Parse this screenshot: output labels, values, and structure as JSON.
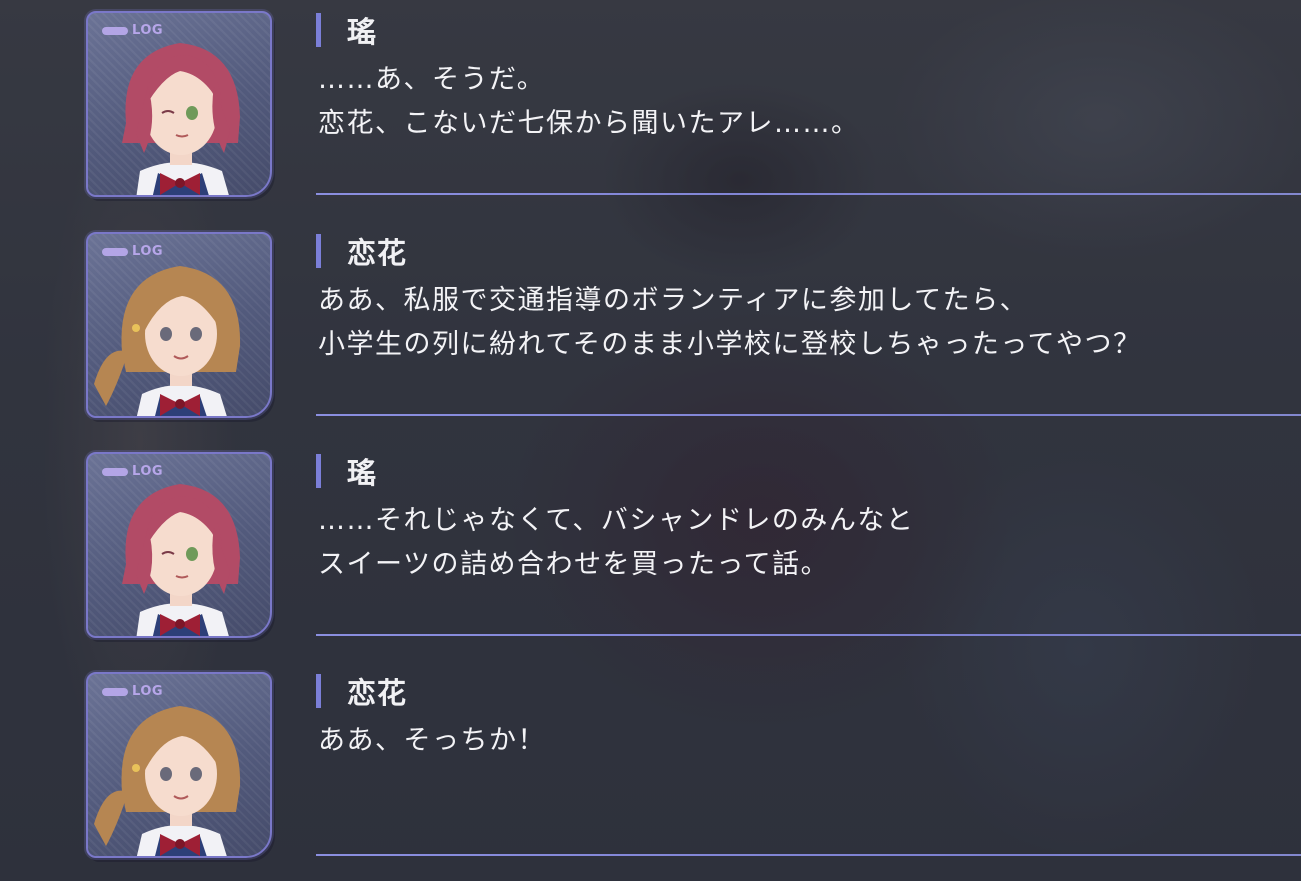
{
  "portrait_tag": "LOG",
  "entries": [
    {
      "speaker": "瑤",
      "character": "red-hair-girl",
      "lines": [
        "……あ、そうだ。",
        "恋花、こないだ七保から聞いたアレ……。"
      ]
    },
    {
      "speaker": "恋花",
      "character": "brown-hair-girl",
      "lines": [
        "ああ、私服で交通指導のボランティアに参加してたら、",
        "小学生の列に紛れてそのまま小学校に登校しちゃったってやつ？"
      ]
    },
    {
      "speaker": "瑤",
      "character": "red-hair-girl",
      "lines": [
        "……それじゃなくて、バシャンドレのみんなと",
        "スイーツの詰め合わせを買ったって話。"
      ]
    },
    {
      "speaker": "恋花",
      "character": "brown-hair-girl",
      "lines": [
        "ああ、そっちか！"
      ]
    }
  ],
  "colors": {
    "accent": "#7b7fd8",
    "frame": "#7a78c9",
    "log_tag": "#b7a6ea",
    "text": "#f3f3f6"
  }
}
